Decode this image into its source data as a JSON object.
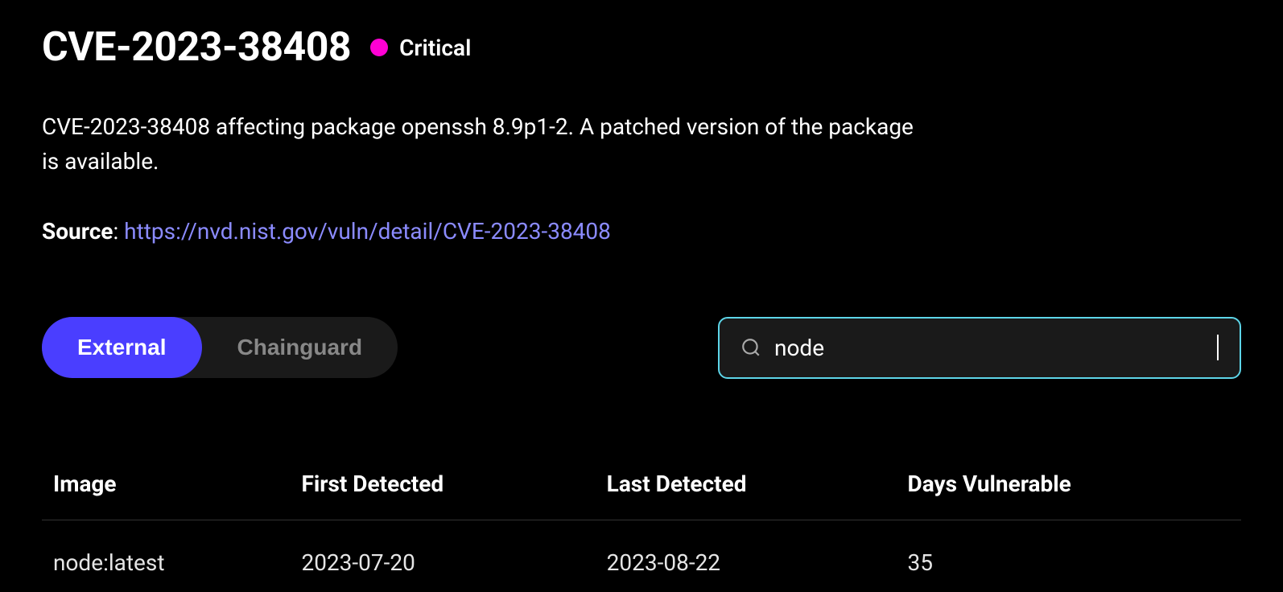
{
  "header": {
    "title": "CVE-2023-38408",
    "severity_label": "Critical",
    "severity_color": "#ff00d4"
  },
  "description": "CVE-2023-38408 affecting package openssh 8.9p1-2. A patched version of the package is available.",
  "source": {
    "label": "Source",
    "url_text": "https://nvd.nist.gov/vuln/detail/CVE-2023-38408"
  },
  "tabs": {
    "items": [
      {
        "label": "External",
        "active": true
      },
      {
        "label": "Chainguard",
        "active": false
      }
    ]
  },
  "search": {
    "value": "node"
  },
  "table": {
    "headers": [
      "Image",
      "First Detected",
      "Last Detected",
      "Days Vulnerable"
    ],
    "rows": [
      {
        "image": "node:latest",
        "first_detected": "2023-07-20",
        "last_detected": "2023-08-22",
        "days_vulnerable": "35"
      }
    ]
  }
}
